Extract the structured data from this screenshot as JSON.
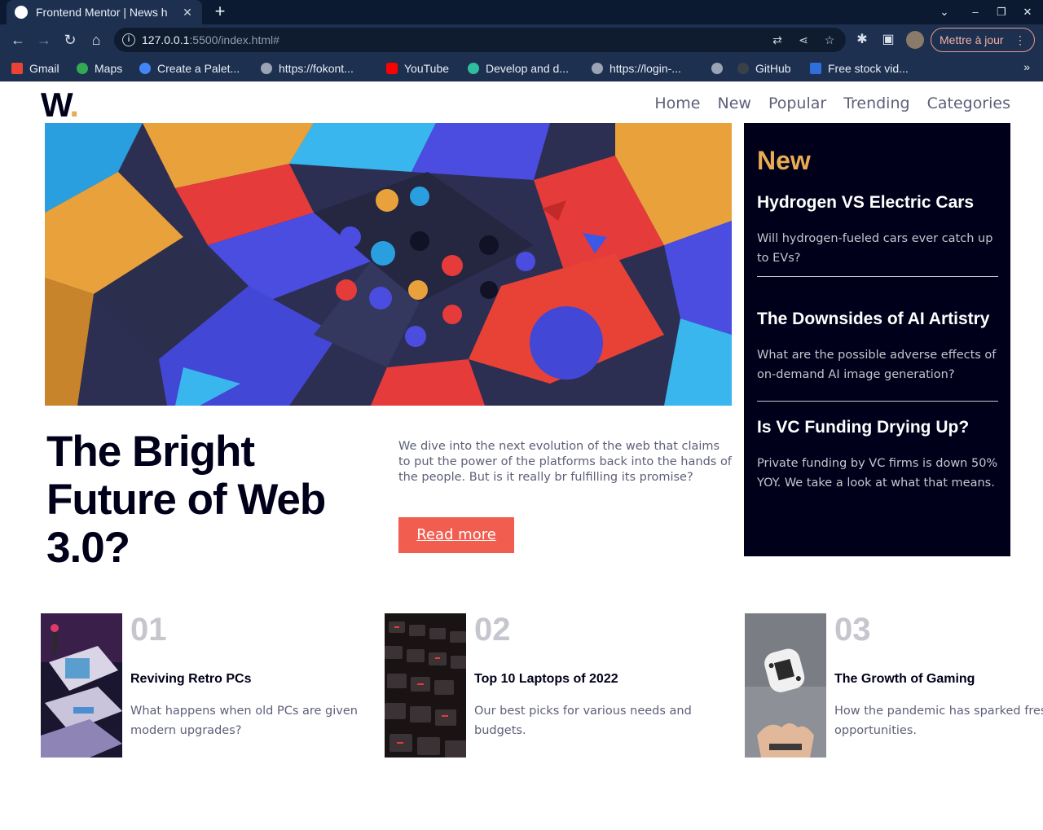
{
  "browser": {
    "tab_title": "Frontend Mentor | News h",
    "tab_close": "✕",
    "new_tab": "+",
    "url_host": "127.0.0.1",
    "url_path": ":5500/index.html#",
    "update_button": "Mettre à jour",
    "bookmarks": [
      {
        "label": "Gmail",
        "icon": "gmail-icon",
        "color": "#ea4335"
      },
      {
        "label": "Maps",
        "icon": "maps-icon",
        "color": "#34a853"
      },
      {
        "label": "Create a Palet...",
        "icon": "palette-icon",
        "color": "#4285f4"
      },
      {
        "label": "https://fokont...",
        "icon": "globe-icon",
        "color": "#9aa4b4"
      },
      {
        "label": "YouTube",
        "icon": "youtube-icon",
        "color": "#ff0000"
      },
      {
        "label": "Develop and d...",
        "icon": "develop-icon",
        "color": "#2fbfa0"
      },
      {
        "label": "https://login-...",
        "icon": "globe-icon",
        "color": "#9aa4b4"
      },
      {
        "label": "",
        "icon": "globe-icon",
        "color": "#9aa4b4"
      },
      {
        "label": "GitHub",
        "icon": "github-icon",
        "color": "#24292e"
      },
      {
        "label": "Free stock vid...",
        "icon": "stock-icon",
        "color": "#2f6fdb"
      }
    ],
    "bookmarks_more": "»"
  },
  "site": {
    "logo": "W",
    "logo_dot": ".",
    "nav": [
      "Home",
      "New",
      "Popular",
      "Trending",
      "Categories"
    ]
  },
  "hero": {
    "title": "The Bright Future of Web 3.0?",
    "description": "We dive into the next evolution of the web that claims to put the power of the platforms back into the hands of the people. But is it really br fulfilling its promise?",
    "button": "Read more"
  },
  "sidebar": {
    "heading": "New",
    "items": [
      {
        "title": "Hydrogen VS Electric Cars",
        "description": "Will hydrogen-fueled cars ever catch up to EVs?"
      },
      {
        "title": "The Downsides of AI Artistry",
        "description": "What are the possible adverse effects of on-demand AI image generation?"
      },
      {
        "title": "Is VC Funding Drying Up?",
        "description": "Private funding by VC firms is down 50% YOY. We take a look at what that means."
      }
    ]
  },
  "cards": [
    {
      "number": "01",
      "title": "Reviving Retro PCs",
      "description": "What happens when old PCs are given modern upgrades?"
    },
    {
      "number": "02",
      "title": "Top 10 Laptops of 2022",
      "description": "Our best picks for various needs and budgets."
    },
    {
      "number": "03",
      "title": "The Growth of Gaming",
      "description": "How the pandemic has sparked fresh opportunities."
    }
  ],
  "colors": {
    "accent_orange": "#e9ab53",
    "button_red": "#f15e50",
    "dark_navy": "#00001a",
    "muted_text": "#5d5f79",
    "light_grey": "#c5c6ce"
  }
}
